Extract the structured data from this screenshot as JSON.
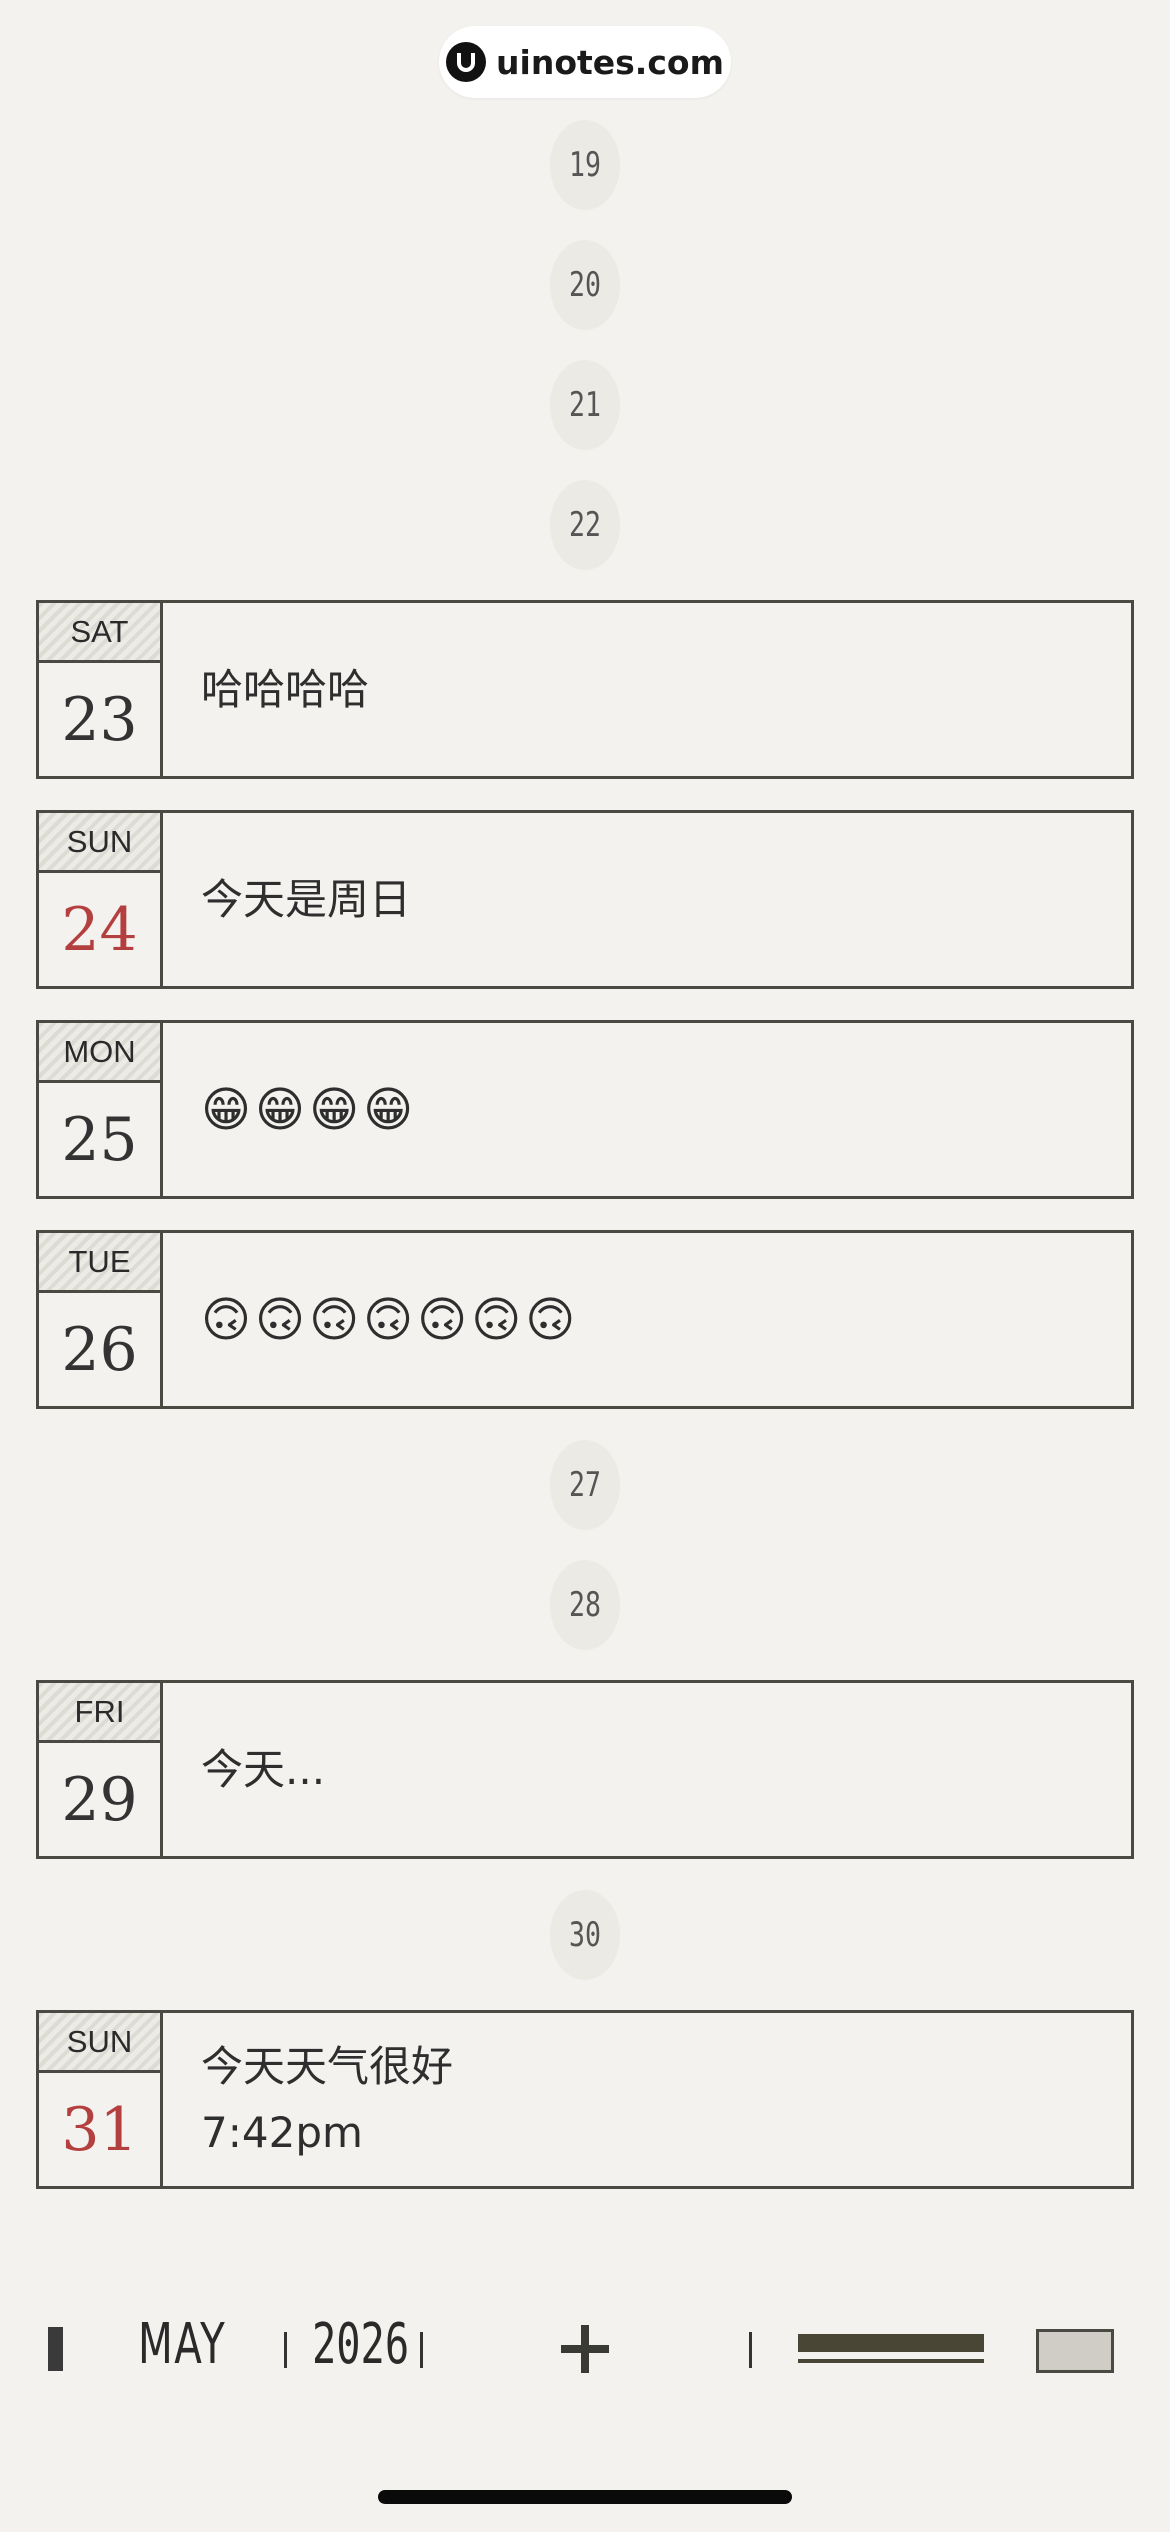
{
  "brand": {
    "text": "uinotes.com",
    "icon": "brand-logo-icon"
  },
  "empty_days": [
    "19",
    "20",
    "21",
    "22",
    "27",
    "28",
    "30"
  ],
  "entries": [
    {
      "dow": "SAT",
      "day": "23",
      "weekend": false,
      "lines": [
        "哈哈哈哈"
      ]
    },
    {
      "dow": "SUN",
      "day": "24",
      "weekend": true,
      "lines": [
        "今天是周日"
      ]
    },
    {
      "dow": "MON",
      "day": "25",
      "weekend": false,
      "lines": [
        "😁😁😁😁"
      ]
    },
    {
      "dow": "TUE",
      "day": "26",
      "weekend": false,
      "lines": [
        "🙃🙃🙃🙃🙃🙃🙃"
      ]
    },
    {
      "dow": "FRI",
      "day": "29",
      "weekend": false,
      "lines": [
        "今天..."
      ]
    },
    {
      "dow": "SUN",
      "day": "31",
      "weekend": true,
      "lines": [
        "今天天气很好",
        "7:42pm"
      ]
    }
  ],
  "toolbar": {
    "month": "MAY",
    "year": "2026",
    "icons": [
      "back-bar-icon",
      "add-icon",
      "list-view-icon",
      "grid-view-icon"
    ]
  },
  "colors": {
    "background": "#f3f2ef",
    "border": "#4a4a42",
    "weekend_red": "#b3403f"
  }
}
